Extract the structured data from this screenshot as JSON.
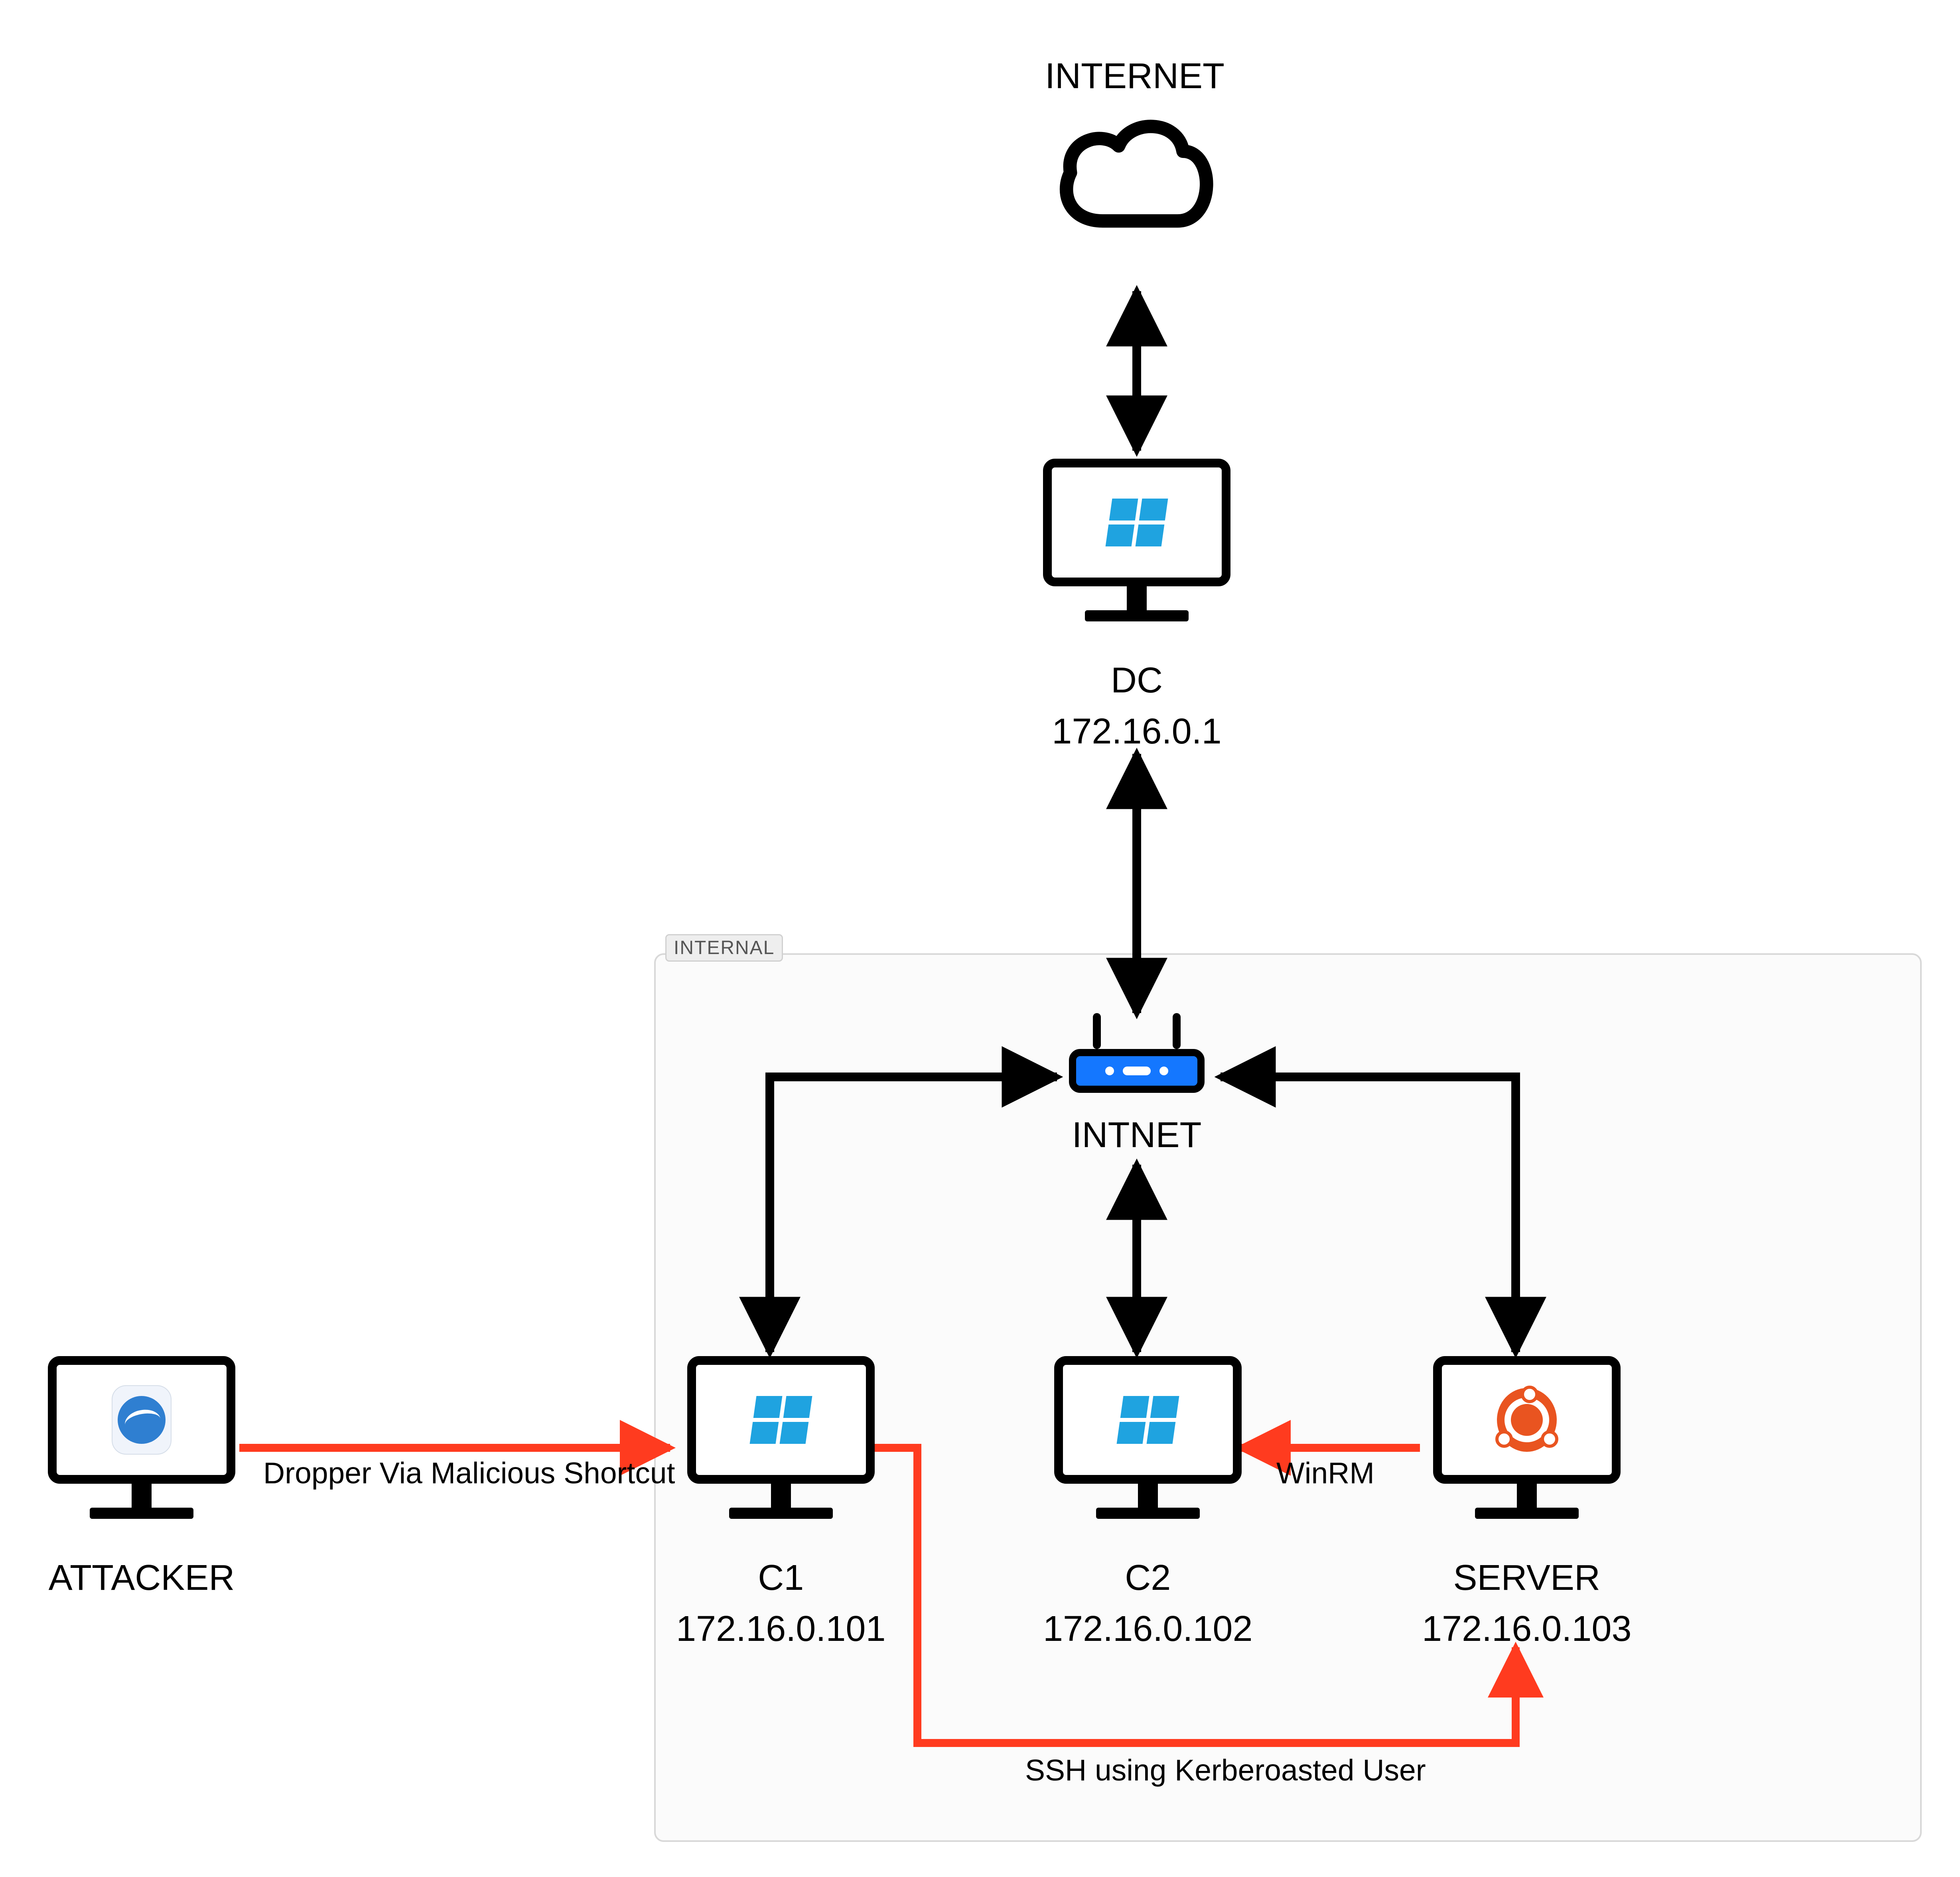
{
  "nodes": {
    "internet": {
      "title": "INTERNET"
    },
    "dc": {
      "label": "DC",
      "ip": "172.16.0.1",
      "os": "windows"
    },
    "attacker": {
      "label": "ATTACKER",
      "os": "kali"
    },
    "c1": {
      "label": "C1",
      "ip": "172.16.0.101",
      "os": "windows"
    },
    "c2": {
      "label": "C2",
      "ip": "172.16.0.102",
      "os": "windows"
    },
    "server": {
      "label": "SERVER",
      "ip": "172.16.0.103",
      "os": "ubuntu"
    },
    "intnet": {
      "label": "INTNET"
    }
  },
  "group": {
    "tag": "INTERNAL"
  },
  "edges": {
    "attacker_c1": {
      "label": "Dropper Via Malicious Shortcut",
      "color": "#ff3b1f",
      "directed": "to"
    },
    "c1_server": {
      "label": "SSH using Kerberoasted User",
      "color": "#ff3b1f",
      "directed": "to"
    },
    "server_c2": {
      "label": "WinRM",
      "color": "#ff3b1f",
      "directed": "to"
    },
    "internet_dc": {
      "color": "#000",
      "directed": "both"
    },
    "dc_intnet": {
      "color": "#000",
      "directed": "both"
    },
    "intnet_c1": {
      "color": "#000",
      "directed": "both"
    },
    "intnet_c2": {
      "color": "#000",
      "directed": "both"
    },
    "intnet_server": {
      "color": "#000",
      "directed": "both"
    }
  },
  "colors": {
    "attack": "#ff3b1f",
    "link": "#000000",
    "router": "#1477ff",
    "windows": "#1fa3e0",
    "ubuntu": "#e95420"
  }
}
